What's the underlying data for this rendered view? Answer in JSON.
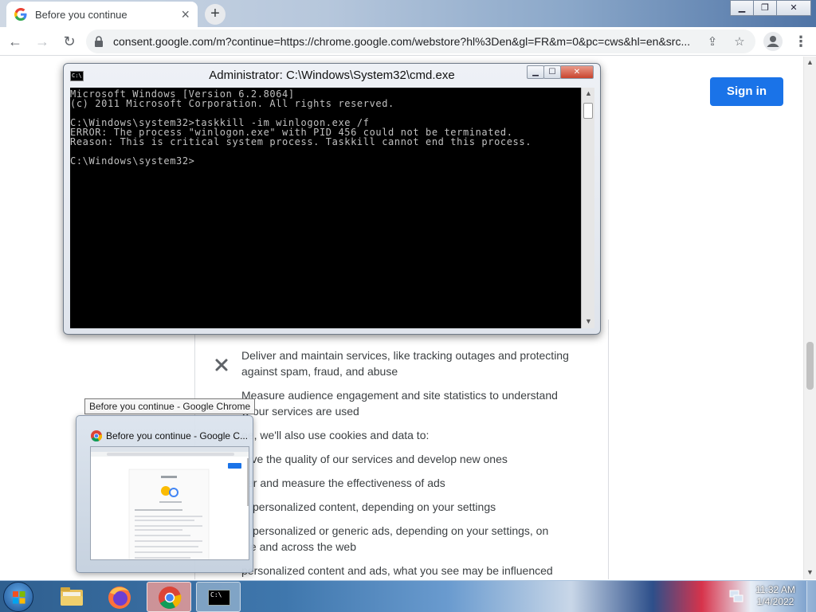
{
  "browser": {
    "tab_title": "Before you continue",
    "tab_close": "×",
    "new_tab": "+",
    "url": "consent.google.com/m?continue=https://chrome.google.com/webstore?hl%3Den&gl=FR&m=0&pc=cws&hl=en&src..."
  },
  "page": {
    "sign_in": "Sign in",
    "lines": [
      "Deliver and maintain services, like tracking outages and protecting",
      "against spam, fraud, and abuse",
      "Measure audience engagement and site statistics to understand",
      "w our services are used",
      "ee, we'll also use cookies and data to:",
      "rove the quality of our services and develop new ones",
      "ver and measure the effectiveness of ads",
      "w personalized content, depending on your settings",
      "w personalized or generic ads, depending on your settings, on",
      "gle and across the web",
      "personalized content and ads, what you see may be influenced"
    ]
  },
  "cmd": {
    "title": "Administrator: C:\\Windows\\System32\\cmd.exe",
    "icon_text": "C:\\",
    "lines": [
      "Microsoft Windows [Version 6.2.8064]",
      "(c) 2011 Microsoft Corporation. All rights reserved.",
      "",
      "C:\\Windows\\system32>taskkill -im winlogon.exe /f",
      "ERROR: The process \"winlogon.exe\" with PID 456 could not be terminated.",
      "Reason: This is critical system process. Taskkill cannot end this process.",
      "",
      "C:\\Windows\\system32>"
    ]
  },
  "preview": {
    "tooltip": "Before you continue - Google Chrome",
    "title": "Before you continue - Google C..."
  },
  "taskbar": {
    "time": "11:32 AM",
    "date": "1/4/2022",
    "cmd_icon_text": "C:\\"
  },
  "colors": {
    "google_blue": "#1a73e8",
    "console_bg": "#000000",
    "console_text": "#c0c0c0"
  }
}
